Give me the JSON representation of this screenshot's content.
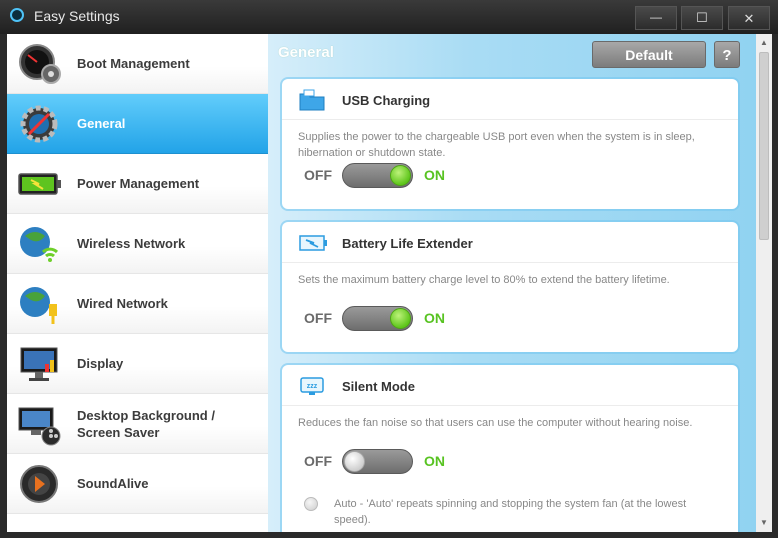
{
  "window": {
    "title": "Easy Settings",
    "minimize_glyph": "—",
    "maximize_glyph": "☐",
    "close_glyph": "✕"
  },
  "sidebar": {
    "items": [
      {
        "label": "Boot Management",
        "icon": "speedometer-gear-icon"
      },
      {
        "label": "General",
        "icon": "gear-icon",
        "selected": true
      },
      {
        "label": "Power Management",
        "icon": "battery-icon"
      },
      {
        "label": "Wireless Network",
        "icon": "wireless-globe-icon"
      },
      {
        "label": "Wired Network",
        "icon": "wired-globe-icon"
      },
      {
        "label": "Display",
        "icon": "monitor-icon"
      },
      {
        "label": "Desktop Background / Screen Saver",
        "label_line1": "Desktop Background /",
        "label_line2": "Screen Saver",
        "icon": "desktop-film-icon"
      },
      {
        "label": "SoundAlive",
        "icon": "speaker-icon"
      }
    ]
  },
  "main": {
    "title": "General",
    "default_button": "Default",
    "help_button": "?",
    "scroll_up_glyph": "▲",
    "scroll_down_glyph": "▼",
    "cards": [
      {
        "title": "USB Charging",
        "icon": "usb-folder-icon",
        "description": "Supplies the power to the chargeable USB port even when the system is in sleep, hibernation or shutdown state.",
        "off_label": "OFF",
        "on_label": "ON",
        "state": "on"
      },
      {
        "title": "Battery Life Extender",
        "icon": "battery-extender-icon",
        "description": "Sets the maximum battery charge level to 80% to extend the battery lifetime.",
        "off_label": "OFF",
        "on_label": "ON",
        "state": "on"
      },
      {
        "title": "Silent Mode",
        "icon": "silent-mode-zzz-icon",
        "description": "Reduces the fan noise so that users can use the computer without hearing noise.",
        "off_label": "OFF",
        "on_label": "ON",
        "state": "off",
        "option_label": "Auto - 'Auto' repeats spinning and stopping the system fan (at the lowest speed)."
      }
    ]
  },
  "colors": {
    "accent_blue": "#22a3e8",
    "on_green": "#58c322",
    "content_bg": "#a9dcf4"
  }
}
